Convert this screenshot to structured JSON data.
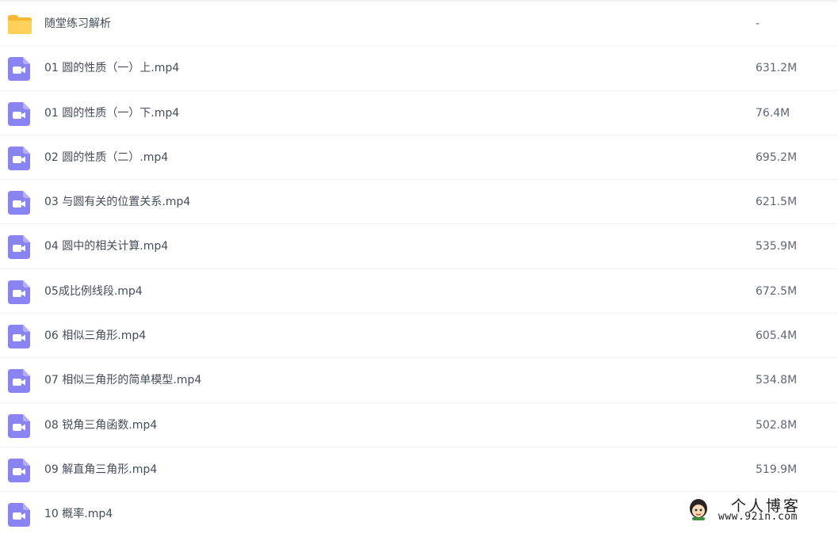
{
  "files": [
    {
      "type": "folder",
      "icon": "folder-icon",
      "name": "随堂练习解析",
      "size": "-"
    },
    {
      "type": "video",
      "icon": "video-file-icon",
      "name": "01 圆的性质（一）上.mp4",
      "size": "631.2M"
    },
    {
      "type": "video",
      "icon": "video-file-icon",
      "name": "01 圆的性质（一）下.mp4",
      "size": "76.4M"
    },
    {
      "type": "video",
      "icon": "video-file-icon",
      "name": "02 圆的性质（二）.mp4",
      "size": "695.2M"
    },
    {
      "type": "video",
      "icon": "video-file-icon",
      "name": "03 与圆有关的位置关系.mp4",
      "size": "621.5M"
    },
    {
      "type": "video",
      "icon": "video-file-icon",
      "name": "04 圆中的相关计算.mp4",
      "size": "535.9M"
    },
    {
      "type": "video",
      "icon": "video-file-icon",
      "name": "05成比例线段.mp4",
      "size": "672.5M"
    },
    {
      "type": "video",
      "icon": "video-file-icon",
      "name": "06 相似三角形.mp4",
      "size": "605.4M"
    },
    {
      "type": "video",
      "icon": "video-file-icon",
      "name": "07 相似三角形的简单模型.mp4",
      "size": "534.8M"
    },
    {
      "type": "video",
      "icon": "video-file-icon",
      "name": "08 锐角三角函数.mp4",
      "size": "502.8M"
    },
    {
      "type": "video",
      "icon": "video-file-icon",
      "name": "09 解直角三角形.mp4",
      "size": "519.9M"
    },
    {
      "type": "video",
      "icon": "video-file-icon",
      "name": "10 概率.mp4",
      "size": ""
    }
  ],
  "watermark": {
    "title": "个人博客",
    "url": "www.92in.com"
  },
  "colors": {
    "folder": "#ffd159",
    "folder_tab": "#f5b937",
    "video": "#8a84f3",
    "divider": "#f1f2f4"
  }
}
